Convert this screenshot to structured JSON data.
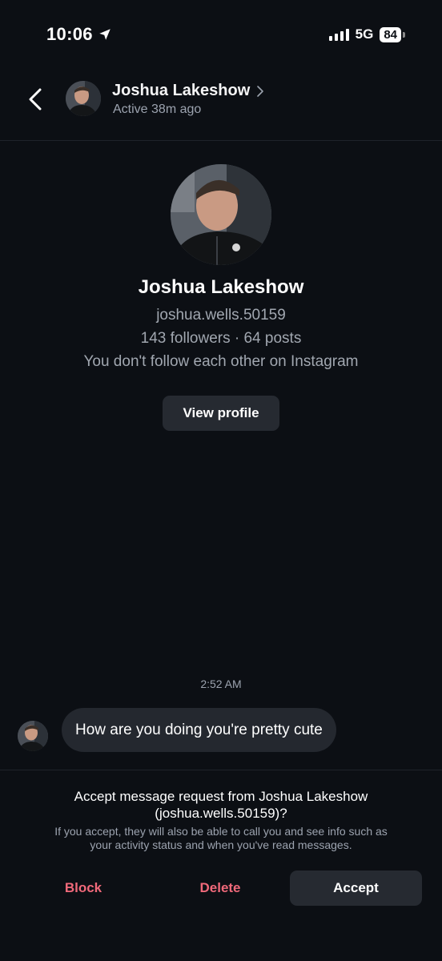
{
  "status_bar": {
    "time": "10:06",
    "network": "5G",
    "battery": "84"
  },
  "header": {
    "name": "Joshua Lakeshow",
    "status": "Active 38m ago"
  },
  "profile": {
    "name": "Joshua Lakeshow",
    "username": "joshua.wells.50159",
    "stats": "143 followers · 64 posts",
    "follow_status": "You don't follow each other on Instagram",
    "view_profile_label": "View profile"
  },
  "chat": {
    "timestamp": "2:52 AM",
    "messages": [
      {
        "text": "How are you doing you're pretty cute"
      }
    ]
  },
  "request": {
    "title_line1": "Accept message request from Joshua Lakeshow",
    "title_line2": "(joshua.wells.50159)?",
    "subtitle_line1": "If you accept, they will also be able to call you and see info such as",
    "subtitle_line2": "your activity status and when you've read messages.",
    "block_label": "Block",
    "delete_label": "Delete",
    "accept_label": "Accept"
  },
  "colors": {
    "background": "#0c0f14",
    "danger": "#f0697a",
    "button_bg": "#262a31",
    "bubble_bg": "#24282f",
    "muted_text": "#a1a7b0"
  },
  "icons": {
    "location": "location-arrow-icon",
    "signal": "cellular-signal-icon",
    "battery": "battery-icon",
    "back": "chevron-left-icon",
    "header_chevron": "chevron-right-icon",
    "avatar": "avatar-photo"
  }
}
